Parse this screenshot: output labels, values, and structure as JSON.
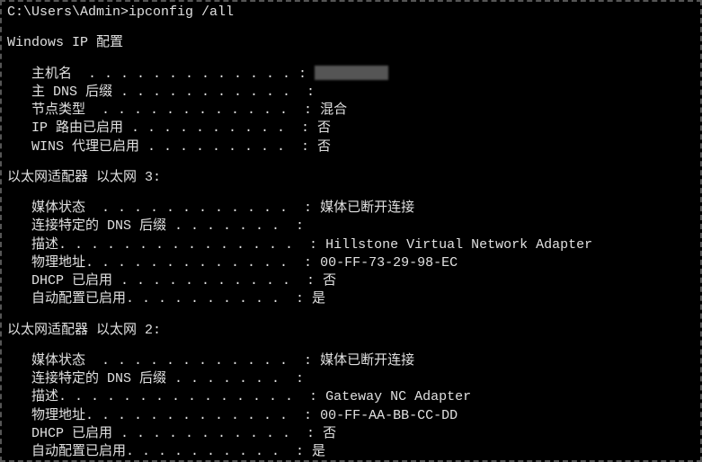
{
  "prompt": "C:\\Users\\Admin>ipconfig /all",
  "header": "Windows IP 配置",
  "host_section": {
    "entries": [
      {
        "label": "   主机名  . . . . . . . . . . . . . : ",
        "value": "",
        "redacted": true
      },
      {
        "label": "   主 DNS 后缀 . . . . . . . . . . .  :",
        "value": ""
      },
      {
        "label": "   节点类型  . . . . . . . . . . . .  : ",
        "value": "混合"
      },
      {
        "label": "   IP 路由已启用 . . . . . . . . . .  : ",
        "value": "否"
      },
      {
        "label": "   WINS 代理已启用 . . . . . . . . .  : ",
        "value": "否"
      }
    ]
  },
  "adapter3": {
    "title": "以太网适配器 以太网 3:",
    "entries": [
      {
        "label": "   媒体状态  . . . . . . . . . . . .  : ",
        "value": "媒体已断开连接"
      },
      {
        "label": "   连接特定的 DNS 后缀 . . . . . . .  :",
        "value": ""
      },
      {
        "label": "   描述. . . . . . . . . . . . . . .  : ",
        "value": "Hillstone Virtual Network Adapter"
      },
      {
        "label": "   物理地址. . . . . . . . . . . . .  : ",
        "value": "00-FF-73-29-98-EC"
      },
      {
        "label": "   DHCP 已启用 . . . . . . . . . . .  : ",
        "value": "否"
      },
      {
        "label": "   自动配置已启用. . . . . . . . . .  : ",
        "value": "是"
      }
    ]
  },
  "adapter2": {
    "title": "以太网适配器 以太网 2:",
    "entries": [
      {
        "label": "   媒体状态  . . . . . . . . . . . .  : ",
        "value": "媒体已断开连接"
      },
      {
        "label": "   连接特定的 DNS 后缀 . . . . . . .  :",
        "value": ""
      },
      {
        "label": "   描述. . . . . . . . . . . . . . .  : ",
        "value": "Gateway NC Adapter"
      },
      {
        "label": "   物理地址. . . . . . . . . . . . .  : ",
        "value": "00-FF-AA-BB-CC-DD"
      },
      {
        "label": "   DHCP 已启用 . . . . . . . . . . .  : ",
        "value": "否"
      },
      {
        "label": "   自动配置已启用. . . . . . . . . .  : ",
        "value": "是"
      }
    ]
  }
}
